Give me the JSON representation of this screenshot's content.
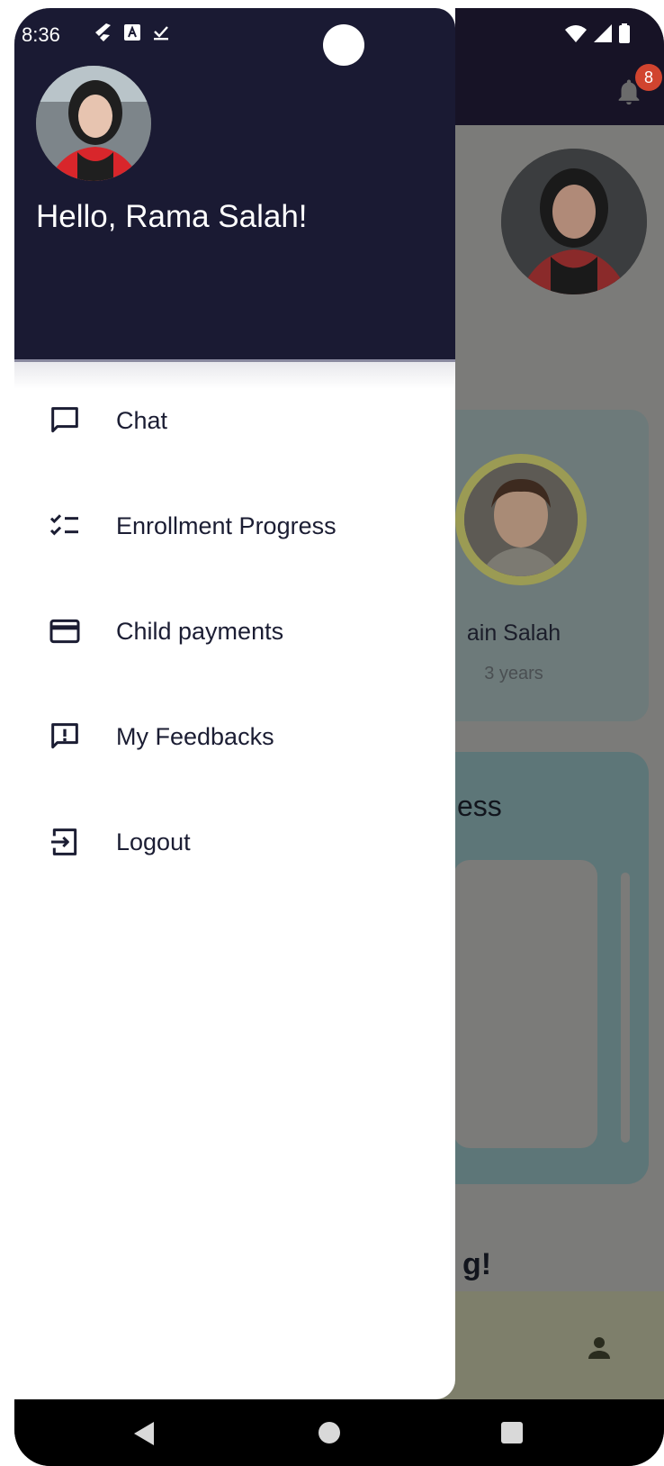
{
  "status_bar": {
    "time": "8:36",
    "left_icons": [
      "flutter-icon",
      "a-box-icon",
      "download-done-icon"
    ],
    "right_icons": [
      "wifi-icon",
      "signal-icon",
      "battery-icon"
    ]
  },
  "background_app": {
    "notification_count": "8",
    "child": {
      "name": "Zain Salah",
      "name_visible": "ain Salah",
      "age": "3 years"
    },
    "progress_title_partial": "ess",
    "greeting_partial": "g!"
  },
  "drawer": {
    "greeting": "Hello, Rama Salah!",
    "menu": [
      {
        "label": "Chat",
        "icon": "chat-icon"
      },
      {
        "label": "Enrollment Progress",
        "icon": "checklist-icon"
      },
      {
        "label": "Child payments",
        "icon": "credit-card-icon"
      },
      {
        "label": "My Feedbacks",
        "icon": "feedback-icon"
      },
      {
        "label": "Logout",
        "icon": "logout-icon"
      }
    ]
  },
  "colors": {
    "drawer_header": "#1a1a33",
    "text_dark": "#1b1d33",
    "badge": "#d1442f"
  }
}
